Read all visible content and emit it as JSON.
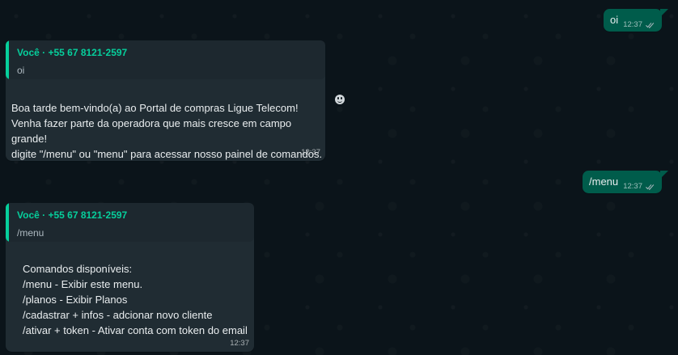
{
  "colors": {
    "background": "#0b141a",
    "outgoing_bubble": "#005c4b",
    "incoming_bubble": "#202c33",
    "quote_accent": "#06cf9c",
    "meta_text": "#aebac1"
  },
  "messages": [
    {
      "id": "out_1",
      "direction": "outgoing",
      "text": "oi",
      "time": "12:37",
      "status_icon": "double-check-icon"
    },
    {
      "id": "in_1",
      "direction": "incoming",
      "quote": {
        "author": "Você · +55 67 8121-2597",
        "text": "oi"
      },
      "text": "Boa tarde bem-vindo(a) ao Portal de compras Ligue Telecom!\nVenha fazer parte da operadora que mais cresce em campo grande!\ndigite \"/menu\" ou \"menu\" para acessar nosso painel de comandos.",
      "time": "12:37"
    },
    {
      "id": "out_2",
      "direction": "outgoing",
      "text": "/menu",
      "time": "12:37",
      "status_icon": "double-check-icon"
    },
    {
      "id": "in_2",
      "direction": "incoming",
      "quote": {
        "author": "Você · +55 67 8121-2597",
        "text": "/menu"
      },
      "text": "Comandos disponíveis:\n/menu - Exibir este menu.\n/planos - Exibir Planos\n/cadastrar + infos - adcionar novo cliente\n/ativar + token - Ativar conta com token do email",
      "time": "12:37"
    }
  ],
  "reaction_button_icon": "emoji-icon"
}
